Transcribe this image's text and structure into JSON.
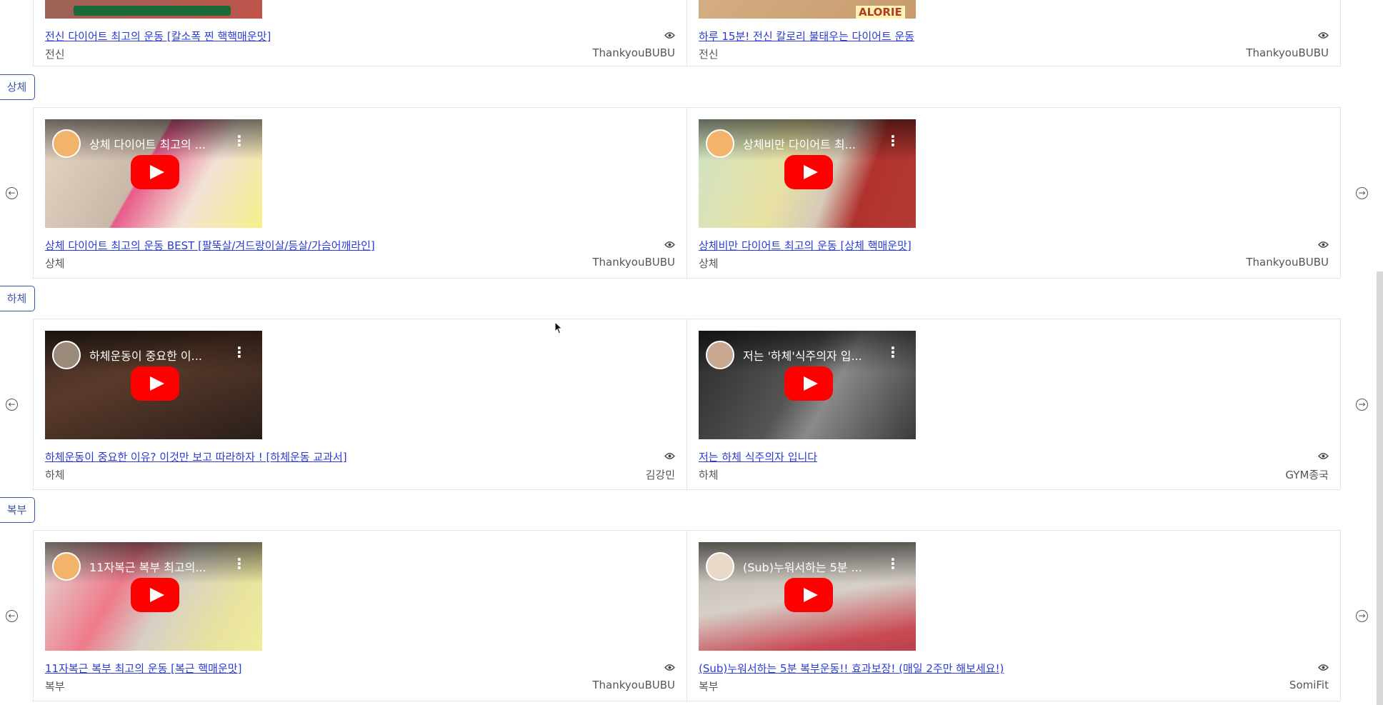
{
  "sections": [
    {
      "label": "상체"
    },
    {
      "label": "하체"
    },
    {
      "label": "복부"
    }
  ],
  "top_row": [
    {
      "link": "전신 다이어트 최고의 운동 [칼소폭 찐 핵핵매운맛]",
      "category": "전신",
      "channel": "ThankyouBUBU",
      "thumb_text": ""
    },
    {
      "link": "하루 15분! 전신 칼로리 불태우는 다이어트 운동",
      "category": "전신",
      "channel": "ThankyouBUBU",
      "thumb_text": "ALORIE"
    }
  ],
  "rows": [
    [
      {
        "thumb_title": "상체 다이어트 최고의 ...",
        "link": "상체 다이어트 최고의 운동 BEST [팔뚝살/겨드랑이살/등살/가슴어깨라인]",
        "category": "상체",
        "channel": "ThankyouBUBU"
      },
      {
        "thumb_title": "상체비만 다이어트 최...",
        "link": "상체비만 다이어트 최고의 운동 [상체 핵매운맛]",
        "category": "상체",
        "channel": "ThankyouBUBU"
      }
    ],
    [
      {
        "thumb_title": "하체운동이 중요한 이...",
        "link": "하체운동이 중요한 이유? 이것만 보고 따라하자 ! [하체운동 교과서]",
        "category": "하체",
        "channel": "김강민"
      },
      {
        "thumb_title": "저는 '하체'식주의자 입...",
        "link": "저는 하체 식주의자 입니다",
        "category": "하체",
        "channel": "GYM종국"
      }
    ],
    [
      {
        "thumb_title": "11자복근 복부 최고의...",
        "link": "11자복근 복부 최고의 운동 [복근 핵매운맛]",
        "category": "복부",
        "channel": "ThankyouBUBU"
      },
      {
        "thumb_title": "(Sub)누워서하는 5분 ...",
        "link": "(Sub)누워서하는 5분 복부운동!! 효과보장! (매일 2주만 해보세요!)",
        "category": "복부",
        "channel": "SomiFit"
      }
    ]
  ],
  "icons": {
    "prev": "arrow-left-circle-icon",
    "next": "arrow-right-circle-icon",
    "views": "eye-icon",
    "play": "youtube-play-icon",
    "menu": "kebab-menu-icon"
  },
  "colors": {
    "link": "#2a3bd7",
    "section_border": "#3c55a8",
    "play_button": "#ff0000"
  }
}
